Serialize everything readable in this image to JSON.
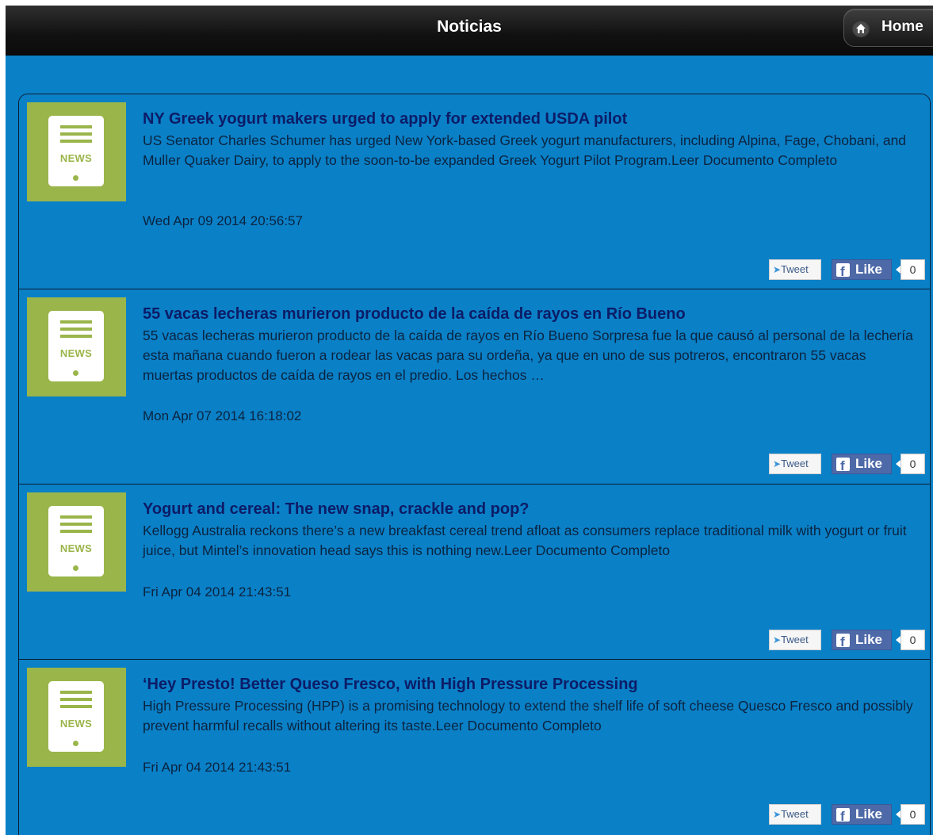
{
  "header": {
    "title": "Noticias",
    "home_label": "Home"
  },
  "social": {
    "tweet_label": "Tweet",
    "like_label": "Like"
  },
  "news": [
    {
      "title": "NY Greek yogurt makers urged to apply for extended USDA pilot",
      "description": "US Senator Charles Schumer has urged New York-based Greek yogurt manufacturers, including Alpina, Fage, Chobani, and Muller Quaker Dairy, to apply to the soon-to-be expanded Greek Yogurt Pilot Program.Leer Documento Completo",
      "date": "Wed Apr 09 2014 20:56:57",
      "like_count": "0",
      "thumb_label": "NEWS"
    },
    {
      "title": "55 vacas lecheras murieron producto de la caída de rayos en Río Bueno",
      "description": "55 vacas lecheras murieron producto de la caída de rayos en Río Bueno Sorpresa fue la que causó al personal de la lechería esta mañana cuando fueron a rodear las vacas para su ordeña, ya que en uno de sus potreros, encontraron 55 vacas muertas productos de caída de rayos en el predio. Los hechos …",
      "date": "Mon Apr 07 2014 16:18:02",
      "like_count": "0",
      "thumb_label": "NEWS"
    },
    {
      "title": "Yogurt and cereal: The new snap, crackle and pop?",
      "description": "Kellogg Australia reckons there’s a new breakfast cereal trend afloat as consumers replace traditional milk with yogurt or fruit juice, but Mintel’s innovation head says this is nothing new.Leer Documento Completo",
      "date": "Fri Apr 04 2014 21:43:51",
      "like_count": "0",
      "thumb_label": "NEWS"
    },
    {
      "title": "‘Hey Presto! Better Queso Fresco, with High Pressure Processing",
      "description": "High Pressure Processing (HPP) is a promising technology to extend the shelf life of soft cheese Quesco Fresco and possibly prevent harmful recalls without altering its taste.Leer Documento Completo",
      "date": "Fri Apr 04 2014 21:43:51",
      "like_count": "0",
      "thumb_label": "NEWS"
    }
  ]
}
